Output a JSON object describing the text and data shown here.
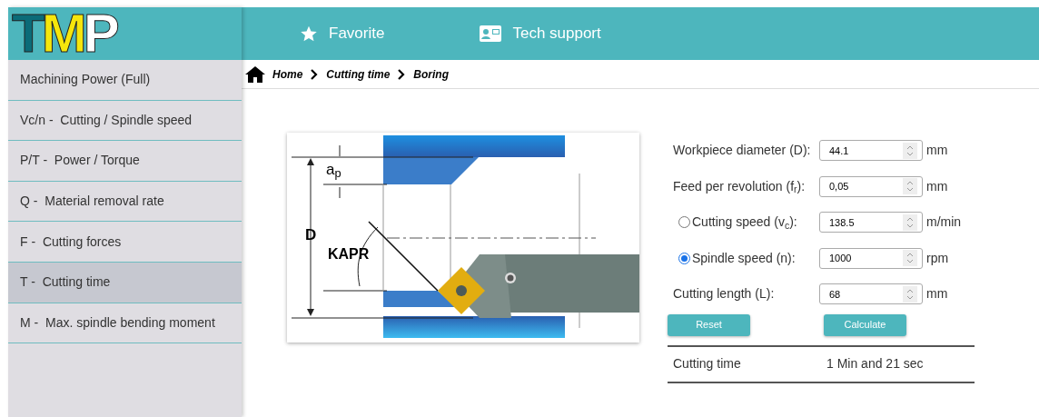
{
  "logo": [
    {
      "text": "T",
      "color": "#0b6b78"
    },
    {
      "text": "M",
      "color": "#f6e60c"
    },
    {
      "text": "P",
      "color": "#ffffff"
    }
  ],
  "header": {
    "links": [
      {
        "kind": "star",
        "label": "Favorite"
      },
      {
        "kind": "card",
        "label": "Tech support"
      }
    ]
  },
  "sidebar": {
    "items": [
      {
        "label": "Machining Power (Full)",
        "selected": false
      },
      {
        "label": "Vc/n -  Cutting / Spindle speed",
        "selected": false
      },
      {
        "label": "P/T -  Power / Torque",
        "selected": false
      },
      {
        "label": "Q -  Material removal rate",
        "selected": false
      },
      {
        "label": "F -  Cutting forces",
        "selected": false
      },
      {
        "label": "T -  Cutting time",
        "selected": true
      },
      {
        "label": "M -  Max. spindle bending moment",
        "selected": false
      }
    ]
  },
  "breadcrumb": [
    "Home",
    "Cutting time",
    "Boring"
  ],
  "diagram": {
    "labels": {
      "ap": "a$_{p}$",
      "d": "D",
      "kapr": "KAPR"
    }
  },
  "form": {
    "rows": [
      {
        "kind": "input",
        "label": "Workpiece diameter (D):",
        "value": "44.1",
        "unit": "mm"
      },
      {
        "kind": "input",
        "label": "Feed per revolution (f$_{r}$):",
        "value": "0,05",
        "unit": "mm"
      },
      {
        "kind": "radio",
        "label": "Cutting speed (v$_{c}$):",
        "selected": false,
        "value": "138.5",
        "unit": "m/min"
      },
      {
        "kind": "radio",
        "label": "Spindle speed (n):",
        "selected": true,
        "value": "1000",
        "unit": "rpm"
      },
      {
        "kind": "input",
        "label": "Cutting length (L):",
        "value": "68",
        "unit": "mm"
      }
    ],
    "buttons": [
      "Reset",
      "Calculate"
    ],
    "result": {
      "label": "Cutting time",
      "value": "1 Min and 21 sec"
    }
  }
}
